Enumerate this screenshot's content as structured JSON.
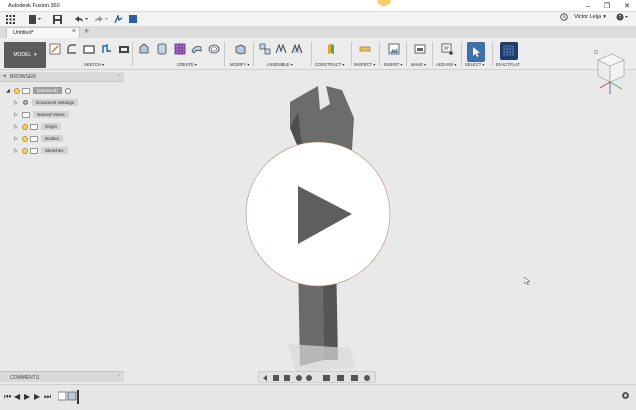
{
  "window": {
    "title": "Autodesk Fusion 360",
    "controls": {
      "minimize": "–",
      "maximize": "❐",
      "close": "✕"
    }
  },
  "quick_access": {
    "user_name": "Victor Leija",
    "user_caret": "▾"
  },
  "document_tab": {
    "label": "Untitled*",
    "close": "×",
    "add": "+"
  },
  "toolbar": {
    "workspace_label": "MODEL",
    "workspace_caret": "▾",
    "groups": [
      {
        "id": "sketch",
        "label": "SKETCH ▾"
      },
      {
        "id": "create",
        "label": "CREATE ▾"
      },
      {
        "id": "modify",
        "label": "MODIFY ▾"
      },
      {
        "id": "assemble",
        "label": "ASSEMBLE ▾"
      },
      {
        "id": "construct",
        "label": "CONSTRUCT ▾"
      },
      {
        "id": "inspect",
        "label": "INSPECT ▾"
      },
      {
        "id": "insert",
        "label": "INSERT ▾"
      },
      {
        "id": "make",
        "label": "MAKE ▾"
      },
      {
        "id": "addins",
        "label": "ADD-INS ▾"
      },
      {
        "id": "select",
        "label": "SELECT ▾"
      },
      {
        "id": "fusion",
        "label": "EXACTFLAT"
      }
    ]
  },
  "browser": {
    "header": "BROWSER",
    "pin": "◦",
    "root_label": "(Unsaved)",
    "items": [
      {
        "label": "Document Settings",
        "bulb": false
      },
      {
        "label": "Named Views",
        "bulb": false
      },
      {
        "label": "Origin",
        "bulb": true
      },
      {
        "label": "Bodies",
        "bulb": true
      },
      {
        "label": "Sketches",
        "bulb": true
      }
    ]
  },
  "comments": {
    "header": "COMMENTS",
    "pin": "◦"
  },
  "colors": {
    "accent_blue": "#2a5f9e",
    "select_blue": "#3f6fa8",
    "wrench_fill": "#6c6c6c",
    "play_circle": "#ffffff",
    "play_triangle": "#5e5e5e"
  }
}
